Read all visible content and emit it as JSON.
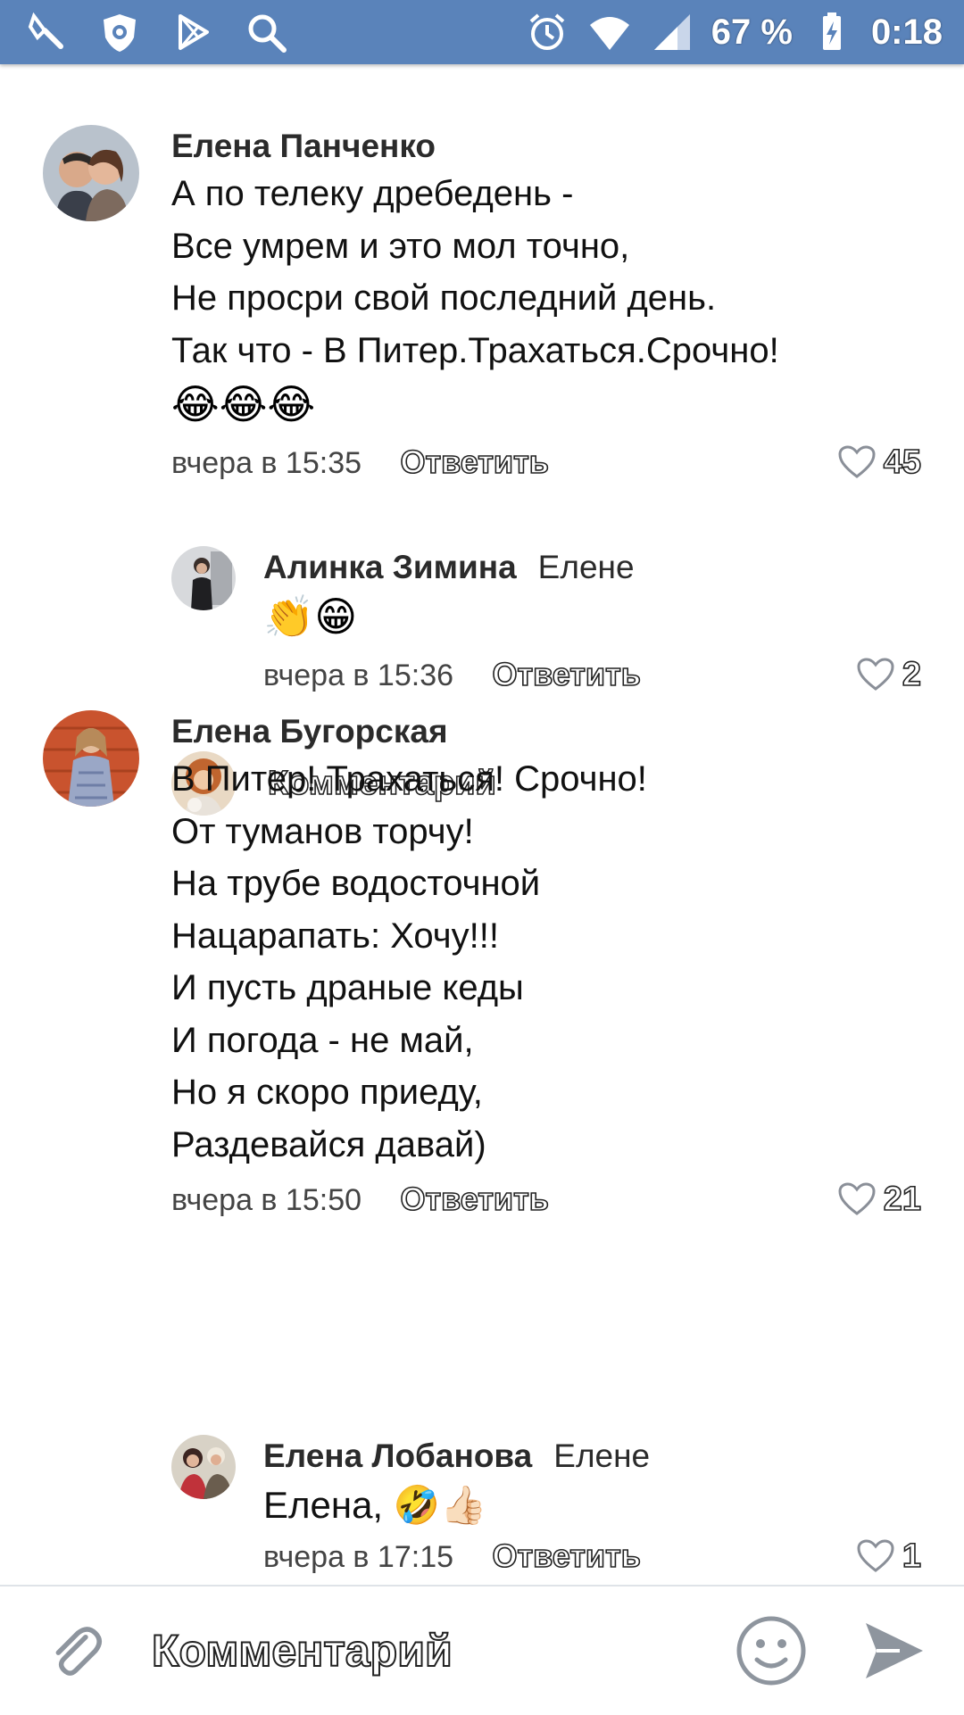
{
  "status_bar": {
    "battery": "67 %",
    "time": "0:18",
    "left_icons": [
      "cleaner-icon",
      "dr-web-icon",
      "play-store-icon",
      "search-icon"
    ],
    "right_icons": [
      "alarm-icon",
      "wifi-icon",
      "signal-icon",
      "battery-charging-icon"
    ]
  },
  "comments": [
    {
      "author": "Елена Панченко",
      "text": "А по телеку дребедень -\nВсе умрем и это мол точно,\nНе просри свой последний день.\nТак что - В Питер.Трахаться.Срочно!",
      "emoji": "😂😂😂",
      "time": "вчера в 15:35",
      "reply_label": "Ответить",
      "likes": "45"
    },
    {
      "author": "Алинка Зимина",
      "to": "Елене",
      "emoji": "👏😁",
      "time": "вчера в 15:36",
      "reply_label": "Ответить",
      "likes": "2"
    },
    {
      "author": "Елена Бугорская",
      "text": "В Питер! Трахаться! Срочно!\nОт туманов торчу!\nНа трубе водосточной\nНацарапать: Хочу!!!\nИ пусть драные кеды\nИ погода - не май,\nНо я скоро приеду,\nРаздевайся давай)",
      "time": "вчера в 15:50",
      "reply_label": "Ответить",
      "likes": "21"
    },
    {
      "author": "Елена Лобанова",
      "to": "Елене",
      "text": "Елена, 🤣👍🏻",
      "time": "вчера в 17:15",
      "reply_label": "Ответить",
      "likes": "1"
    }
  ],
  "inline_reply": {
    "placeholder": "Комментарий"
  },
  "input_bar": {
    "placeholder": "Комментарий",
    "icons": [
      "paperclip-icon",
      "smiley-icon",
      "send-icon"
    ]
  },
  "colors": {
    "status_bar": "#5a83ba",
    "like_heart": "#8a8f98"
  }
}
